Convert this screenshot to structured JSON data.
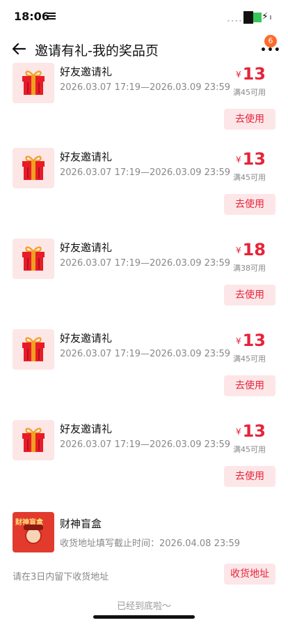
{
  "status": {
    "time": "18:06"
  },
  "nav": {
    "title": "邀请有礼-我的奖品页",
    "badge": "6"
  },
  "coupons": [
    {
      "title": "好友邀请礼",
      "time": "2026.03.07 17:19—2026.03.09 23:59",
      "currency": "¥",
      "amount": "13",
      "condition": "满45可用",
      "button": "去使用"
    },
    {
      "title": "好友邀请礼",
      "time": "2026.03.07 17:19—2026.03.09 23:59",
      "currency": "¥",
      "amount": "13",
      "condition": "满45可用",
      "button": "去使用"
    },
    {
      "title": "好友邀请礼",
      "time": "2026.03.07 17:19—2026.03.09 23:59",
      "currency": "¥",
      "amount": "18",
      "condition": "满38可用",
      "button": "去使用"
    },
    {
      "title": "好友邀请礼",
      "time": "2026.03.07 17:19—2026.03.09 23:59",
      "currency": "¥",
      "amount": "13",
      "condition": "满45可用",
      "button": "去使用"
    },
    {
      "title": "好友邀请礼",
      "time": "2026.03.07 17:19—2026.03.09 23:59",
      "currency": "¥",
      "amount": "13",
      "condition": "满45可用",
      "button": "去使用"
    }
  ],
  "blindbox": {
    "image_label": "财神盲盒",
    "title": "财神盲盒",
    "deadline": "收货地址填写截止时间：2026.04.08 23:59",
    "hint": "请在3日内留下收货地址",
    "button": "收货地址"
  },
  "footer": {
    "text": "已经到底啦～"
  },
  "colors": {
    "accent": "#e6243a",
    "accent_bg": "#fde6e8",
    "badge": "#ff6a2a"
  }
}
